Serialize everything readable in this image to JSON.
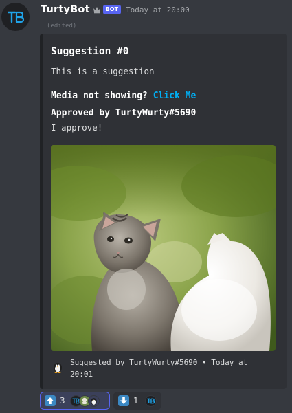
{
  "message": {
    "author": "TurtyBot",
    "bot_tag": "BOT",
    "timestamp": "Today at 20:00",
    "edited": "(edited)"
  },
  "embed": {
    "title": "Suggestion #0",
    "description": "This is a suggestion",
    "media_prefix": "Media not showing?",
    "media_link": "Click Me",
    "approved_title": "Approved by TurtyWurty#5690",
    "approved_text": "I approve!",
    "image_icon": "kittens-photo",
    "footer": "Suggested by TurtyWurty#5690 • Today at 20:01"
  },
  "reactions": [
    {
      "emoji": "arrow-up-icon",
      "count": "3"
    },
    {
      "emoji": "arrow-down-icon",
      "count": "1"
    }
  ],
  "colors": {
    "background": "#36393f",
    "embed_background": "#2f3136",
    "link": "#00aff4",
    "bot_tag": "#5865f2",
    "reaction_arrow": "#3b88c3"
  }
}
